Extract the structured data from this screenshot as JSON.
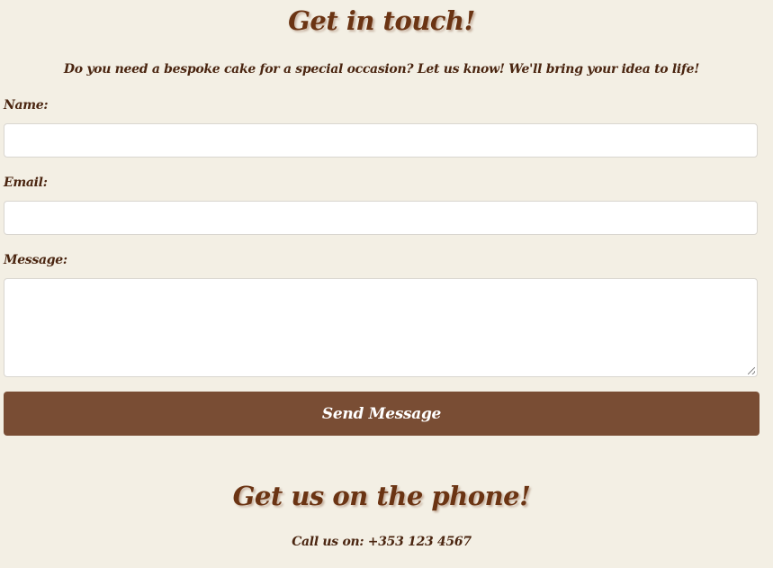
{
  "contact": {
    "title": "Get in touch!",
    "intro": "Do you need a bespoke cake for a special occasion? Let us know! We'll bring your idea to life!",
    "name_label": "Name:",
    "name_value": "",
    "email_label": "Email:",
    "email_value": "",
    "message_label": "Message:",
    "message_value": "",
    "submit_label": "Send Message"
  },
  "phone": {
    "title": "Get us on the phone!",
    "text": "Call us on: +353 123 4567"
  },
  "colors": {
    "background": "#f3efe4",
    "heading": "#6b3413",
    "text": "#4a2510",
    "button": "#794d34",
    "button_text": "#ffffff"
  }
}
